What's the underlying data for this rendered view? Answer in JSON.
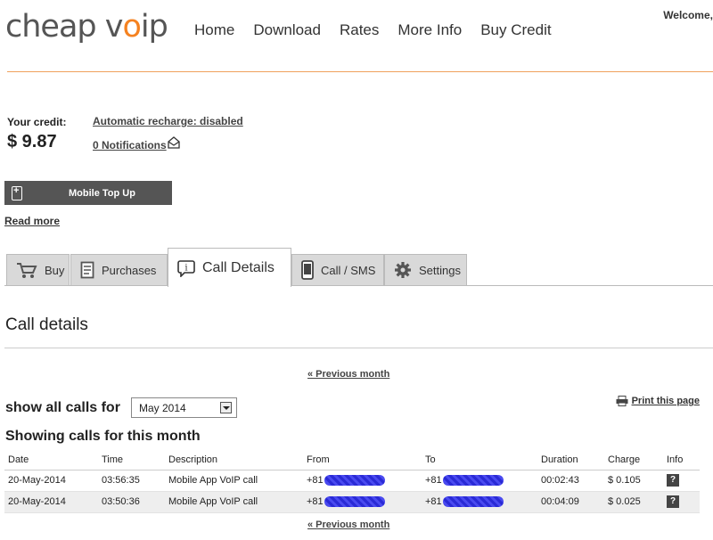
{
  "header": {
    "logo_prefix": "cheap v",
    "logo_o": "o",
    "logo_suffix": "ip",
    "nav": [
      "Home",
      "Download",
      "Rates",
      "More Info",
      "Buy Credit"
    ],
    "welcome": "Welcome,"
  },
  "account": {
    "credit_label": "Your credit:",
    "credit_value": "$ 9.87",
    "auto_recharge": "Automatic recharge: disabled",
    "notifications": "0 Notifications",
    "topup_label": "Mobile Top Up",
    "read_more": "Read more"
  },
  "tabs": [
    {
      "label": "Buy",
      "icon": "cart-icon",
      "active": false
    },
    {
      "label": "Purchases",
      "icon": "document-icon",
      "active": false
    },
    {
      "label": "Call Details",
      "icon": "info-bubble-icon",
      "active": true
    },
    {
      "label": "Call / SMS",
      "icon": "mobile-phone-icon",
      "active": false
    },
    {
      "label": "Settings",
      "icon": "gear-icon",
      "active": false
    }
  ],
  "call_details": {
    "title": "Call details",
    "prev_month": "« Previous month",
    "show_label": "show all calls for",
    "month_selected": "May 2014",
    "print": "Print this page",
    "showing": "Showing calls for this month",
    "columns": [
      "Date",
      "Time",
      "Description",
      "From",
      "To",
      "Duration",
      "Charge",
      "Info"
    ],
    "rows": [
      {
        "date": "20-May-2014",
        "time": "03:56:35",
        "description": "Mobile App VoIP call",
        "from": "+81",
        "to": "+81",
        "duration": "00:02:43",
        "charge": "$ 0.105",
        "info": "?"
      },
      {
        "date": "20-May-2014",
        "time": "03:50:36",
        "description": "Mobile App VoIP call",
        "from": "+81",
        "to": "+81",
        "duration": "00:04:09",
        "charge": "$ 0.025",
        "info": "?"
      }
    ]
  },
  "colors": {
    "accent": "#f58220",
    "topup_bg": "#555555",
    "tab_inactive": "#d9d9d9"
  }
}
